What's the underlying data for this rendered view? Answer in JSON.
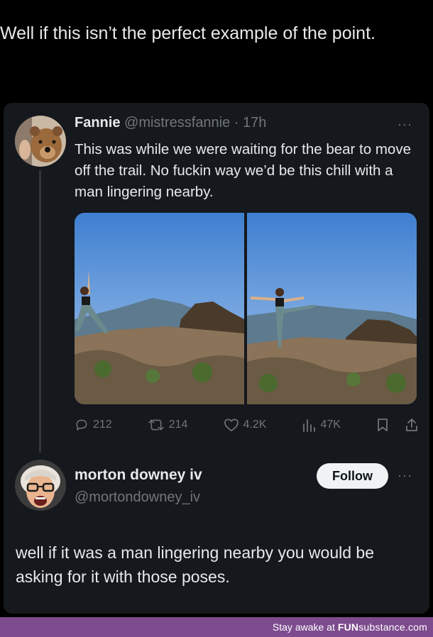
{
  "caption": "Well if this isn’t the perfect example of the point.",
  "tweet": {
    "author_name": "Fannie",
    "author_meta": " @mistressfannie · 17h",
    "text": "This was while we were waiting for the bear to move off the trail. No fuckin way we’d be this chill with a man lingering nearby.",
    "more_icon": "···",
    "stats": {
      "replies": "212",
      "retweets": "214",
      "likes": "4.2K",
      "views": "47K"
    }
  },
  "reply": {
    "author_name": "morton downey iv",
    "handle": "@mortondowney_iv",
    "follow_label": "Follow",
    "more_icon": "···",
    "text": "well if it was a man lingering nearby you would be asking for it with those poses."
  },
  "footer": {
    "prefix": "Stay awake at",
    "brand_bold": "FUN",
    "brand_rest": "substance",
    "brand_suffix": ".com"
  },
  "icons": [
    "reply-icon",
    "retweet-icon",
    "like-icon",
    "views-icon",
    "bookmark-icon",
    "share-icon",
    "more-icon"
  ]
}
